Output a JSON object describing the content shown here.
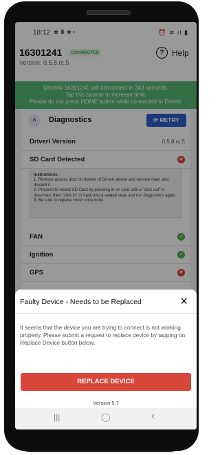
{
  "status_bar": {
    "time": "18:12",
    "left_icons": "♚ ♜ ♚ •",
    "right_icons": "⏰ ≋ ıl ▮"
  },
  "header": {
    "device_id": "16301241",
    "connection_status": "CONNECTED",
    "version_text": "Version: 0.5.8.rc.5",
    "help_label": "Help"
  },
  "banner": {
    "line1": "Driveri# 16301241 will disconnect in 343 seconds.",
    "line2": "Tap this banner to increase time.",
    "line3": "Please do not press HOME button while connected to Driveri."
  },
  "diagnostics": {
    "title": "Diagnostics",
    "retry_label": "RETRY",
    "rows": {
      "driveri_version": {
        "label": "Driveri Version",
        "value": "0.5.8.rc.5"
      },
      "sd_card": {
        "label": "SD Card Detected",
        "status": "fail"
      },
      "fan": {
        "label": "FAN",
        "status": "ok"
      },
      "ignition": {
        "label": "Ignition",
        "status": "ok"
      },
      "gps": {
        "label": "GPS",
        "status": "fail"
      }
    },
    "instructions": {
      "title": "Instructions:",
      "step1": "1. Remove access door on bottom of Driveri device and remove foam and discard it.",
      "step2": "2. Proceed to reseat SD Card by pressing in on card until a \"click out\" is observed; then \"click in\" or back into a seated state and run diagnostics again.",
      "step3": "3. Be sure to replace cover once done."
    }
  },
  "modal": {
    "title": "Faulty Device - Needs to be Replaced",
    "message": "It seems that the device you are trying to connect is not working properly. Please submit a request to replace device by tapping on Replace Device button below.",
    "button_label": "REPLACE DEVICE",
    "app_version": "Version 5.7"
  },
  "nav_bar": {
    "recents": "|||",
    "home": "◯",
    "back": "‹"
  },
  "colors": {
    "banner": "#57b874",
    "retry": "#2d5fc9",
    "replace": "#d9473b",
    "ok": "#4caf50",
    "fail": "#d9453b"
  },
  "icons": {
    "help": "help-circle-icon",
    "retry": "refresh-icon",
    "collapse": "chevron-up-icon",
    "close": "close-icon"
  }
}
